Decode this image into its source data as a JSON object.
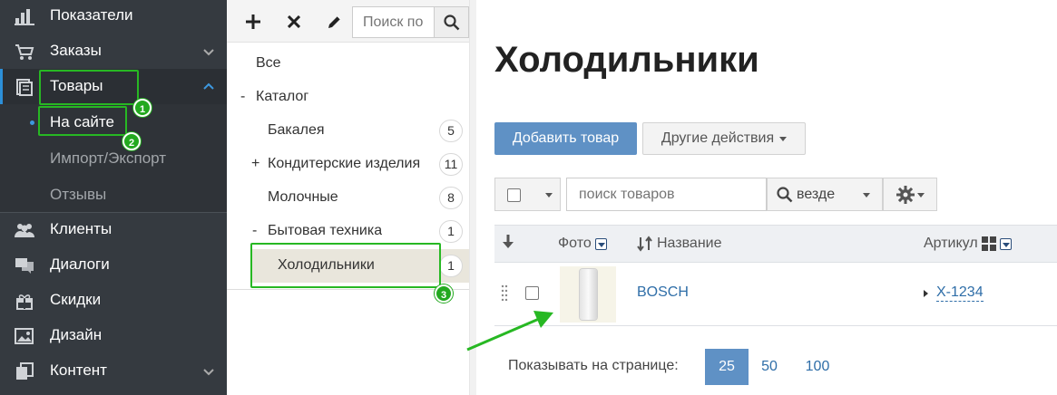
{
  "sidebar": {
    "items": [
      {
        "label": "Показатели",
        "icon": "bar-chart-icon"
      },
      {
        "label": "Заказы",
        "icon": "cart-icon"
      },
      {
        "label": "Товары",
        "icon": "products-icon"
      },
      {
        "label": "Клиенты",
        "icon": "users-icon"
      },
      {
        "label": "Диалоги",
        "icon": "chat-icon"
      },
      {
        "label": "Скидки",
        "icon": "gift-icon"
      },
      {
        "label": "Дизайн",
        "icon": "image-icon"
      },
      {
        "label": "Контент",
        "icon": "copy-icon"
      }
    ],
    "subitems": [
      {
        "label": "На сайте"
      },
      {
        "label": "Импорт/Экспорт"
      },
      {
        "label": "Отзывы"
      }
    ]
  },
  "categories": {
    "search_placeholder": "Поиск по",
    "toolbar_icons": [
      "plus-icon",
      "times-icon",
      "pencil-icon",
      "search-icon"
    ],
    "rows": [
      {
        "name": "Все",
        "sign": "",
        "count": ""
      },
      {
        "name": "Каталог",
        "sign": "-",
        "count": ""
      },
      {
        "name": "Бакалея",
        "sign": "",
        "count": "5"
      },
      {
        "name": "Кондитерские изделия",
        "sign": "+",
        "count": "11"
      },
      {
        "name": "Молочные",
        "sign": "",
        "count": "8"
      },
      {
        "name": "Бытовая техника",
        "sign": "-",
        "count": "1"
      },
      {
        "name": "Холодильники",
        "sign": "",
        "count": "1"
      }
    ]
  },
  "main": {
    "title": "Холодильники",
    "add_button": "Добавить товар",
    "other_actions": "Другие действия",
    "filter": {
      "search_placeholder": "поиск товаров",
      "scope": "везде"
    },
    "table": {
      "headers": {
        "photo": "Фото",
        "name": "Название",
        "sku": "Артикул"
      },
      "rows": [
        {
          "name": "BOSCH",
          "sku": "X-1234"
        }
      ]
    },
    "pager": {
      "label": "Показывать на странице:",
      "options": [
        "25",
        "50",
        "100"
      ],
      "selected": "25"
    }
  },
  "annotations": {
    "badges": [
      "1",
      "2",
      "3"
    ],
    "color": "#27b823"
  },
  "colors": {
    "sidebar_bg": "#353a40",
    "accent": "#5f91c5",
    "link": "#2f6ea8",
    "highlight": "#27b823"
  }
}
